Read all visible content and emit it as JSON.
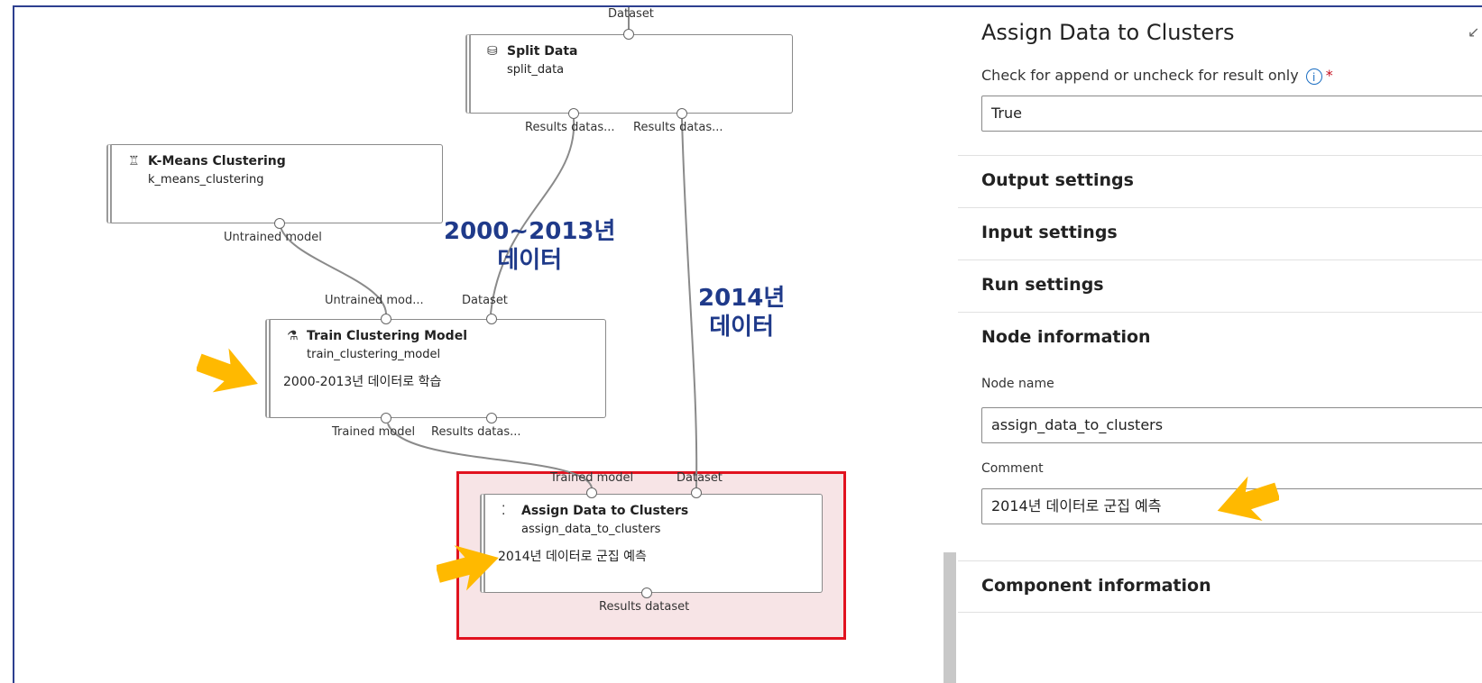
{
  "pipeline": {
    "top_input_label": "Dataset",
    "split_data": {
      "title": "Split Data",
      "id": "split_data",
      "out1_label": "Results datas...",
      "out2_label": "Results datas..."
    },
    "kmeans": {
      "title": "K-Means Clustering",
      "id": "k_means_clustering",
      "out_label": "Untrained model"
    },
    "train": {
      "title": "Train Clustering Model",
      "id": "train_clustering_model",
      "comment": "2000-2013년 데이터로 학습",
      "in1_label": "Untrained mod...",
      "in2_label": "Dataset",
      "out1_label": "Trained model",
      "out2_label": "Results datas..."
    },
    "assign": {
      "title": "Assign Data to Clusters",
      "id": "assign_data_to_clusters",
      "comment": "2014년 데이터로 군집 예측",
      "in1_label": "Trained model",
      "in2_label": "Dataset",
      "out_label": "Results dataset"
    },
    "annotation_left": {
      "line1": "2000~2013년",
      "line2": "데이터"
    },
    "annotation_right": {
      "line1": "2014년",
      "line2": "데이터"
    }
  },
  "panel": {
    "title": "Assign Data to Clusters",
    "append_label": "Check for append or uncheck for result only",
    "append_info": "i",
    "required_mark": "*",
    "append_value": "True",
    "sections": {
      "output": "Output settings",
      "input": "Input settings",
      "run": "Run settings",
      "node_info": "Node information",
      "component": "Component information"
    },
    "node_name_label": "Node name",
    "node_name_value": "assign_data_to_clusters",
    "comment_label": "Comment",
    "comment_value": "2014년 데이터로 군집 예측"
  },
  "colors": {
    "highlight_border": "#e1121f",
    "highlight_fill": "#f7e4e6",
    "annotation_text": "#1f3a8a",
    "arrow": "#ffb900"
  },
  "icons": {
    "split": "database-split-icon",
    "kmeans": "tree-hierarchy-icon",
    "train": "train-model-icon",
    "assign": "scatter-plot-icon",
    "info": "info-icon",
    "expand": "expand-icon"
  }
}
